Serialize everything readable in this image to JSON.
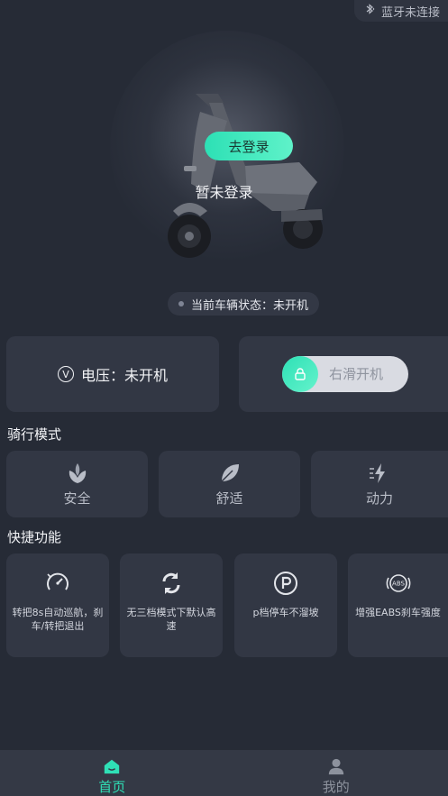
{
  "bluetooth": {
    "status": "蓝牙未连接",
    "icon": "bluetooth-icon"
  },
  "hero": {
    "login_button": "去登录",
    "login_status": "暂未登录"
  },
  "vehicle_status": "当前车辆状态：未开机",
  "voltage": {
    "label": "电压：未开机",
    "icon": "voltage-icon"
  },
  "power_slider": {
    "label": "右滑开机",
    "icon": "lock-icon"
  },
  "riding_mode": {
    "title": "骑行模式",
    "modes": [
      {
        "label": "安全",
        "icon": "lotus-icon"
      },
      {
        "label": "舒适",
        "icon": "leaf-icon"
      },
      {
        "label": "动力",
        "icon": "lightning-icon"
      }
    ]
  },
  "quick_functions": {
    "title": "快捷功能",
    "items": [
      {
        "label": "转把8s自动巡航，刹车/转把退出",
        "icon": "speedometer-icon"
      },
      {
        "label": "无三档模式下默认高速",
        "icon": "refresh-icon"
      },
      {
        "label": "p档停车不溜坡",
        "icon": "parking-icon"
      },
      {
        "label": "增强EABS刹车强度",
        "icon": "abs-icon"
      }
    ]
  },
  "bottom_nav": {
    "items": [
      {
        "label": "首页",
        "icon": "home-icon",
        "active": true
      },
      {
        "label": "我的",
        "icon": "user-icon",
        "active": false
      }
    ]
  },
  "colors": {
    "accent": "#2fe0b6",
    "background": "#262b36",
    "card": "#323744"
  }
}
